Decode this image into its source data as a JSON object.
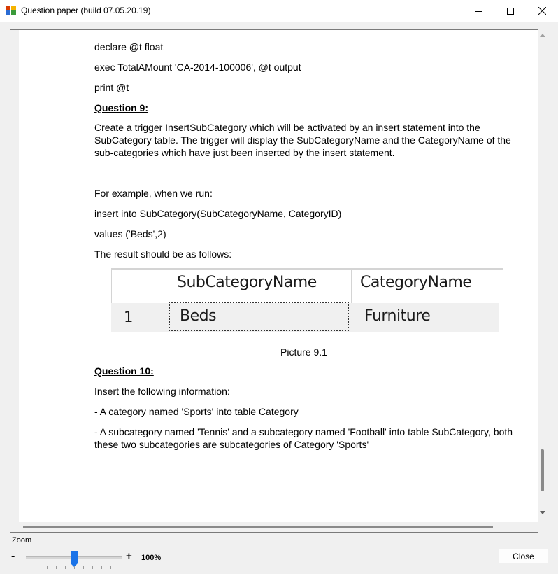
{
  "window": {
    "title": "Question paper (build 07.05.20.19)",
    "icons": {
      "app": "app-icon",
      "minimize": "minimize-icon",
      "maximize": "maximize-icon",
      "close": "close-icon"
    }
  },
  "document": {
    "lines": {
      "declare": "declare @t float",
      "exec": "exec TotalAMount 'CA-2014-100006', @t output",
      "print": "print @t"
    },
    "q9": {
      "heading": "Question 9:",
      "text": "Create a trigger InsertSubCategory which will be activated by an insert statement into the SubCategory table. The trigger will display the SubCategoryName and the CategoryName of the sub-categories which have just been inserted by the insert statement.",
      "example": "For example, when we run:",
      "insert": "insert into SubCategory(SubCategoryName, CategoryID)",
      "values": "values ('Beds',2)",
      "result": "The result should be as follows:"
    },
    "result_table": {
      "headers": [
        "",
        "SubCategoryName",
        "CategoryName"
      ],
      "rows": [
        {
          "num": "1",
          "subcategory": "Beds",
          "category": "Furniture"
        }
      ]
    },
    "caption": "Picture 9.1",
    "q10": {
      "heading": "Question 10:",
      "intro": "Insert the following information:",
      "item1": "- A category named 'Sports' into table Category",
      "item2": "- A subcategory named 'Tennis' and a subcategory named 'Football' into table SubCategory, both these two subcategories are subcategories of Category 'Sports'"
    }
  },
  "zoom": {
    "label": "Zoom",
    "minus": "-",
    "plus": "+",
    "value": "100%",
    "slider_position": 0.47
  },
  "buttons": {
    "close": "Close"
  },
  "colors": {
    "slider_accent": "#1a73e8",
    "window_bg": "#f0f0f0"
  }
}
